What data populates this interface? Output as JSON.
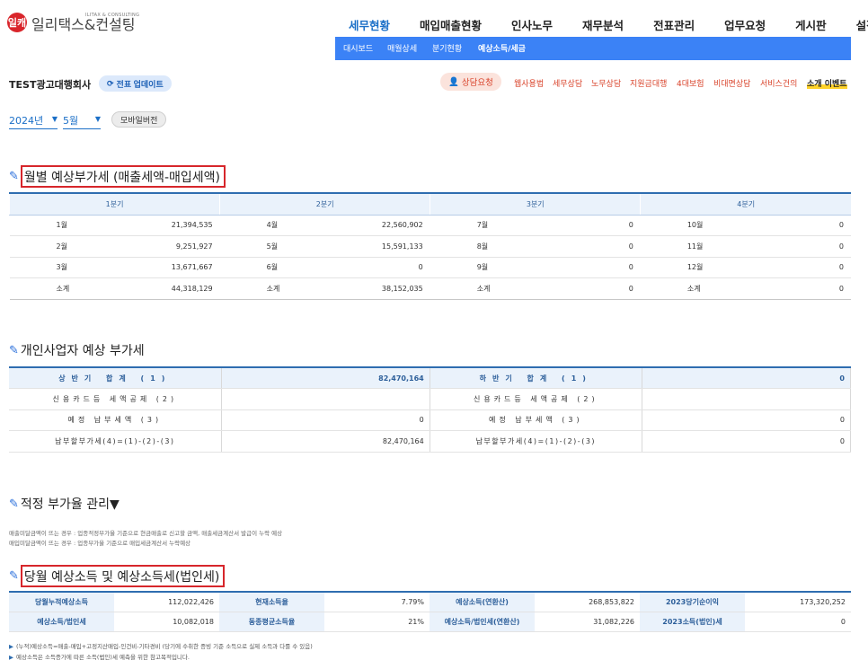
{
  "logo": {
    "mark": "일캐",
    "name": "일리택스&컨설팅",
    "sub": "ILITAX & CONSULTING"
  },
  "mainnav": [
    "세무현황",
    "매입매출현황",
    "인사노무",
    "재무분석",
    "전표관리",
    "업무요청",
    "게시판",
    "설정"
  ],
  "subnav": [
    "대시보드",
    "매월상세",
    "분기현황",
    "예상소득/세금"
  ],
  "company": "TEST광고대행회사",
  "update_btn": "전표 업데이트",
  "consult_btn": "상담요청",
  "links": [
    "웹사용법",
    "세무상담",
    "노무상담",
    "지원금대행",
    "4대보험",
    "비대면상담",
    "서비스건의",
    "소개 이벤트"
  ],
  "year": "2024년",
  "month": "5월",
  "mobile_btn": "모바일버전",
  "section1": {
    "title": "월별 예상부가세 (매출세액-매입세액)",
    "quarters": [
      "1분기",
      "2분기",
      "3분기",
      "4분기"
    ],
    "rows": [
      [
        "1월",
        "21,394,535",
        "4월",
        "22,560,902",
        "7월",
        "0",
        "10월",
        "0"
      ],
      [
        "2월",
        "9,251,927",
        "5월",
        "15,591,133",
        "8월",
        "0",
        "11월",
        "0"
      ],
      [
        "3월",
        "13,671,667",
        "6월",
        "0",
        "9월",
        "0",
        "12월",
        "0"
      ],
      [
        "소계",
        "44,318,129",
        "소계",
        "38,152,035",
        "소계",
        "0",
        "소계",
        "0"
      ]
    ]
  },
  "section2": {
    "title": "개인사업자 예상 부가세",
    "rows": [
      [
        "상반기 합계 (1)",
        "82,470,164",
        "하반기 합계 (1)",
        "0"
      ],
      [
        "신용카드등 세액공제 (2)",
        "",
        "신용카드등 세액공제 (2)",
        ""
      ],
      [
        "예정 납부세액 (3)",
        "0",
        "예정 납부세액 (3)",
        "0"
      ],
      [
        "납부할부가세(4)=(1)-(2)-(3)",
        "82,470,164",
        "납부할부가세(4)=(1)-(2)-(3)",
        "0"
      ]
    ]
  },
  "section3": {
    "title": "적정 부가율 관리▼",
    "desc1": "매출미달금액이 뜨는 경우 : 업종적정부가율 기준으로 현금매출로 신고할 금액, 매출세금계산서 발급이 누락 예상",
    "desc2": "매입미달금액이 뜨는 경우 : 업종부가율 기준으로 매입세금계산서 누락예상"
  },
  "section4": {
    "title": "당월 예상소득 및 예상소득세(법인세)",
    "rows": [
      [
        "당월누적예상소득",
        "112,022,426",
        "현재소득율",
        "7.79%",
        "예상소득(연환산)",
        "268,853,822",
        "2023당기순이익",
        "173,320,252"
      ],
      [
        "예상소득/법인세",
        "10,082,018",
        "동종평균소득율",
        "21%",
        "예상소득/법인세(연환산)",
        "31,082,226",
        "2023소득(법인)세",
        "0"
      ]
    ],
    "note1": "(누적)예상소득=매출-매입+고정지산매입-인건비-기타경비 (당기에 수취한 증빙 기준 소득으로 실제 소득과 다를 수 있음)",
    "note2": "예상소득은 소득증가에 따른 소득(법인)세 예측을 위한 참고목적입니다."
  }
}
